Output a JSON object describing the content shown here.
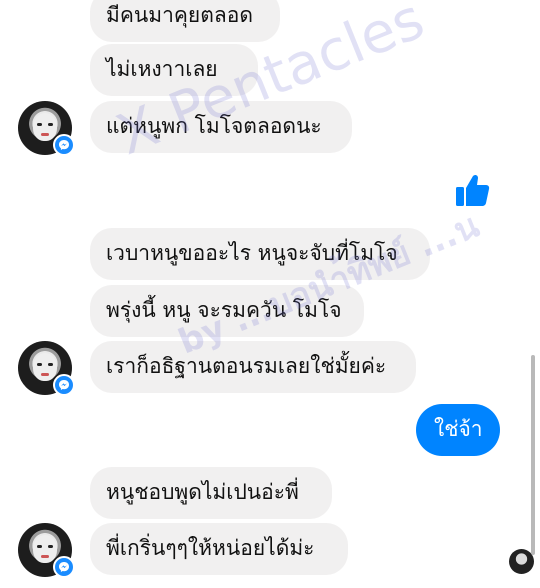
{
  "colors": {
    "incoming_bubble": "#f1f0f0",
    "outgoing_bubble": "#0084ff",
    "messenger_badge": "#1a8cff",
    "like_icon": "#0084ff"
  },
  "messages": [
    {
      "direction": "incoming",
      "text": "มีคนมาคุยตลอด"
    },
    {
      "direction": "incoming",
      "text": "ไม่เหงาาเลย"
    },
    {
      "direction": "incoming",
      "text": "แต่หนูพก โมโจตลอดนะ"
    },
    {
      "direction": "outgoing",
      "type": "like",
      "icon": "thumbs-up-icon"
    },
    {
      "direction": "incoming",
      "text": "เวบาหนูขออะไร หนูจะจับที่โมโจ"
    },
    {
      "direction": "incoming",
      "text": "พรุ่งนี้ หนู จะรมควัน โมโจ"
    },
    {
      "direction": "incoming",
      "text": "เราก็อธิฐานตอนรมเลยใช่มั้ยค่ะ"
    },
    {
      "direction": "outgoing",
      "text": "ใช่จ้า"
    },
    {
      "direction": "incoming",
      "text": "หนูชอบพูดไม่เปนอ่ะพี่"
    },
    {
      "direction": "incoming",
      "text": "พี่เกริ่นๆๆให้หน่อยได้ม่ะ"
    }
  ],
  "icons": {
    "avatar_badge": "messenger-icon",
    "like": "thumbs-up-icon",
    "seen": "seen-avatar"
  },
  "watermark": {
    "line1": "X Pentacles",
    "line2": "by ...บอนำ้ทิพย์ ...น"
  }
}
